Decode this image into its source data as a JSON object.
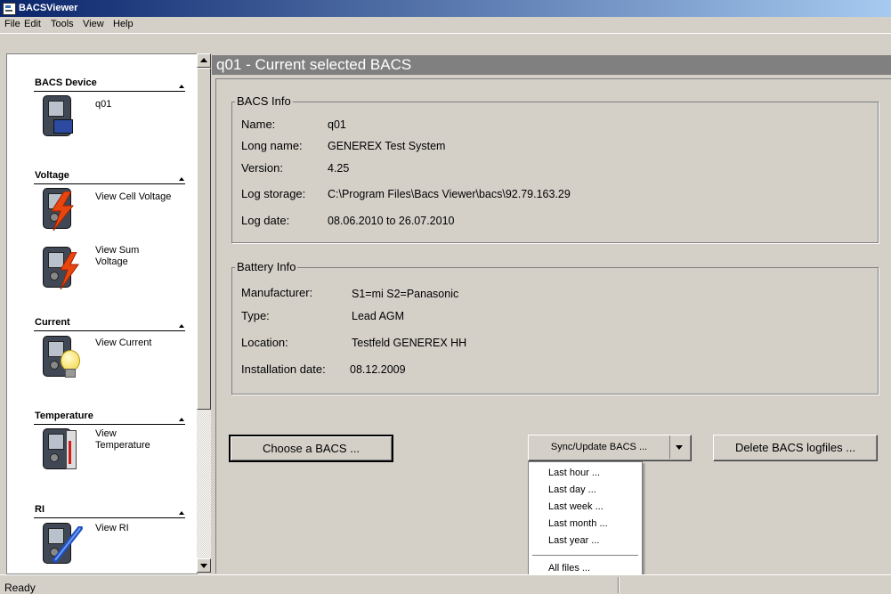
{
  "window": {
    "title": "BACSViewer"
  },
  "menu": [
    "File",
    "Edit",
    "Tools",
    "View",
    "Help"
  ],
  "sidebar": {
    "groups": [
      {
        "title": "BACS Device",
        "items": [
          {
            "label": "q01",
            "icon": "bacs-device-icon"
          }
        ]
      },
      {
        "title": "Voltage",
        "items": [
          {
            "label": "View Cell Voltage",
            "icon": "cell-voltage-icon"
          },
          {
            "label": "View Sum Voltage",
            "icon": "sum-voltage-icon"
          }
        ]
      },
      {
        "title": "Current",
        "items": [
          {
            "label": "View Current",
            "icon": "current-bulb-icon"
          }
        ]
      },
      {
        "title": "Temperature",
        "items": [
          {
            "label": "View Temperature",
            "icon": "thermometer-icon"
          }
        ]
      },
      {
        "title": "RI",
        "items": [
          {
            "label": "View RI",
            "icon": "ri-probe-icon"
          }
        ]
      }
    ]
  },
  "main": {
    "header": "q01 - Current selected BACS",
    "bacs_info": {
      "legend": "BACS Info",
      "rows": [
        {
          "label": "Name:",
          "value": "q01"
        },
        {
          "label": "Long name:",
          "value": "GENEREX Test System"
        },
        {
          "label": "Version:",
          "value": "4.25"
        },
        {
          "label": "Log storage:",
          "value": "C:\\Program Files\\Bacs Viewer\\bacs\\92.79.163.29"
        },
        {
          "label": "Log date:",
          "value": "08.06.2010 to 26.07.2010"
        }
      ]
    },
    "battery_info": {
      "legend": "Battery Info",
      "rows": [
        {
          "label": "Manufacturer:",
          "value": "S1=mi S2=Panasonic"
        },
        {
          "label": "Type:",
          "value": "Lead AGM"
        },
        {
          "label": "Location:",
          "value": "Testfeld GENEREX HH"
        },
        {
          "label": "Installation date:",
          "value": "08.12.2009"
        }
      ]
    },
    "buttons": {
      "choose": "Choose a BACS ...",
      "sync": "Sync/Update BACS ...",
      "delete": "Delete BACS logfiles ..."
    },
    "sync_menu": [
      "Last hour ...",
      "Last day ...",
      "Last week ...",
      "Last month ...",
      "Last year ...",
      "All files ..."
    ]
  },
  "status": {
    "text": "Ready"
  },
  "colors": {
    "title_start": "#0a246a",
    "title_end": "#a6caf0",
    "header_bg": "#808080",
    "face": "#d4d0c8"
  }
}
